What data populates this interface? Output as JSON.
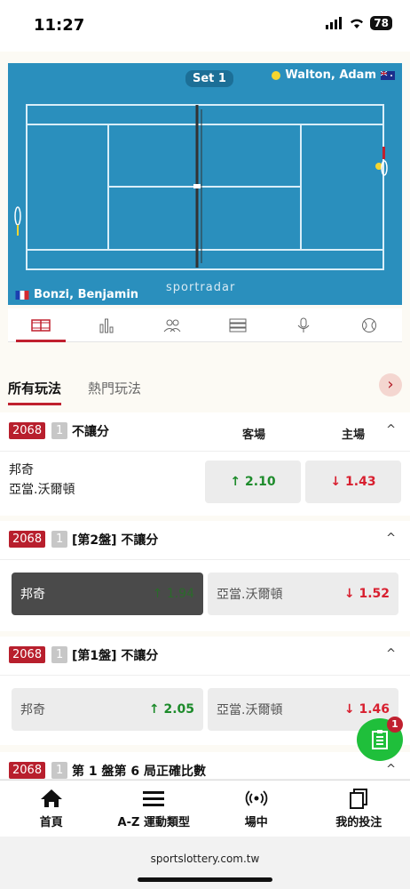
{
  "status": {
    "time": "11:27",
    "battery": "78"
  },
  "court": {
    "set_label": "Set 1",
    "player_top": "Walton, Adam",
    "player_bottom": "Bonzi, Benjamin",
    "logo": "sportradar"
  },
  "tabs": [
    "court-tab",
    "stats-tab",
    "players-tab",
    "list-tab",
    "mic-tab",
    "ball-tab"
  ],
  "market_tabs": {
    "all": "所有玩法",
    "hot": "熱門玩法"
  },
  "markets": [
    {
      "id": "2068",
      "num": "1",
      "title": "不讓分",
      "col_away": "客場",
      "col_home": "主場",
      "team1": "邦奇",
      "team2": "亞當.沃爾頓",
      "odd_away": "↑ 2.10",
      "odd_home": "↓ 1.43"
    },
    {
      "id": "2068",
      "num": "1",
      "title": "[第2盤] 不讓分",
      "left_name": "邦奇",
      "left_odd": "↑ 1.94",
      "right_name": "亞當.沃爾頓",
      "right_odd": "↓ 1.52"
    },
    {
      "id": "2068",
      "num": "1",
      "title": "[第1盤] 不讓分",
      "left_name": "邦奇",
      "left_odd": "↑ 2.05",
      "right_name": "亞當.沃爾頓",
      "right_odd": "↓ 1.46"
    },
    {
      "id": "2068",
      "num": "1",
      "title": "第 1 盤第 6 局正確比數"
    }
  ],
  "bet_slip_count": "1",
  "bottom_nav": [
    {
      "label": "首頁",
      "icon": "home-icon"
    },
    {
      "label": "A-Z 運動類型",
      "icon": "menu-icon"
    },
    {
      "label": "場中",
      "icon": "live-icon"
    },
    {
      "label": "我的投注",
      "icon": "mybets-icon"
    }
  ],
  "url": "sportslottery.com.tw",
  "colors": {
    "brand": "#b81f2d",
    "up": "#1d8b2b",
    "down": "#d81f2f",
    "court": "#2a8fbd"
  }
}
